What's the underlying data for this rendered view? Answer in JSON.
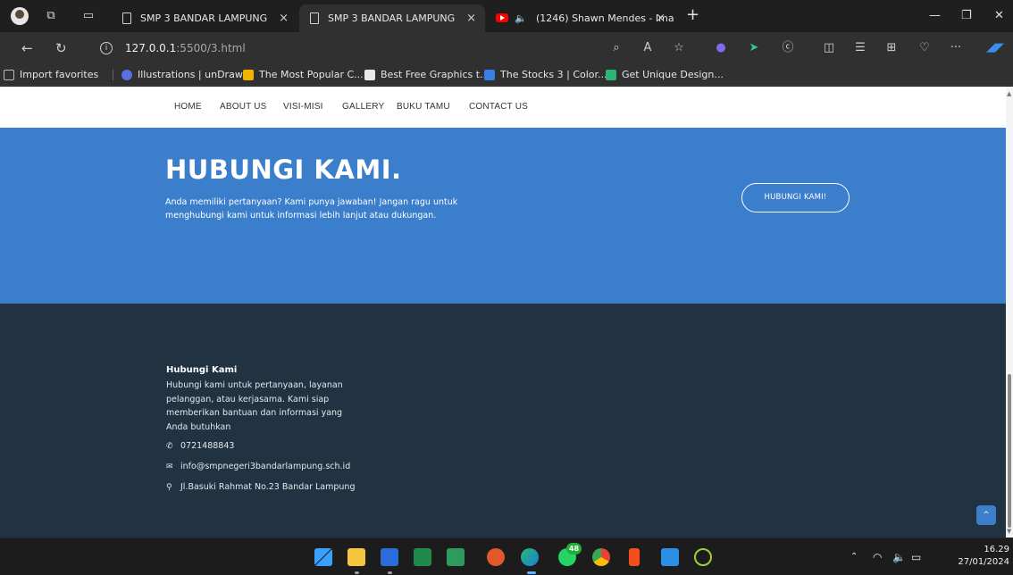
{
  "browser": {
    "tabs": [
      {
        "title": "SMP 3 BANDAR LAMPUNG",
        "close": "×",
        "active": false
      },
      {
        "title": "SMP 3 BANDAR LAMPUNG",
        "close": "×",
        "active": true
      },
      {
        "title": "(1246) Shawn Mendes - Ima",
        "close": "×",
        "active": false
      }
    ],
    "new_tab": "+",
    "window_controls": {
      "minimize": "—",
      "restore": "❐",
      "close": "✕"
    },
    "address": {
      "host": "127.0.0.1",
      "path": ":5500/3.html"
    },
    "more": "···",
    "favorites": [
      {
        "label": "Import favorites",
        "color": "#9a9a9a"
      },
      {
        "label": "Illustrations | unDraw",
        "color": "#5a6ee6"
      },
      {
        "label": "The Most Popular C...",
        "color": "#f0b400"
      },
      {
        "label": "Best Free Graphics t...",
        "color": "#1a1a1a"
      },
      {
        "label": "The Stocks 3 | Color...",
        "color": "#3a7ee6"
      },
      {
        "label": "Get Unique Design...",
        "color": "#2bb673"
      }
    ]
  },
  "site": {
    "nav": [
      "HOME",
      "ABOUT US",
      "VISI-MISI",
      "GALLERY",
      "BUKU TAMU",
      "CONTACT US"
    ],
    "hero": {
      "title": "HUBUNGI KAMI.",
      "text": "Anda memiliki pertanyaan? Kami punya jawaban! Jangan ragu untuk menghubungi kami untuk informasi lebih lanjut atau dukungan.",
      "button": "HUBUNGI KAMI!"
    },
    "footer": {
      "title": "Hubungi Kami",
      "description": "Hubungi kami untuk pertanyaan, layanan pelanggan, atau kerjasama. Kami siap memberikan bantuan dan informasi yang Anda butuhkan",
      "phone": "0721488843",
      "email": "info@smpnegeri3bandarlampung.sch.id",
      "address": "Jl.Basuki Rahmat No.23 Bandar Lampung"
    },
    "back_to_top": "^"
  },
  "taskbar": {
    "badge": "48",
    "time": "16.29",
    "date": "27/01/2024"
  },
  "colors": {
    "hero_bg": "#3b7ecb",
    "footer_bg": "#213242"
  }
}
